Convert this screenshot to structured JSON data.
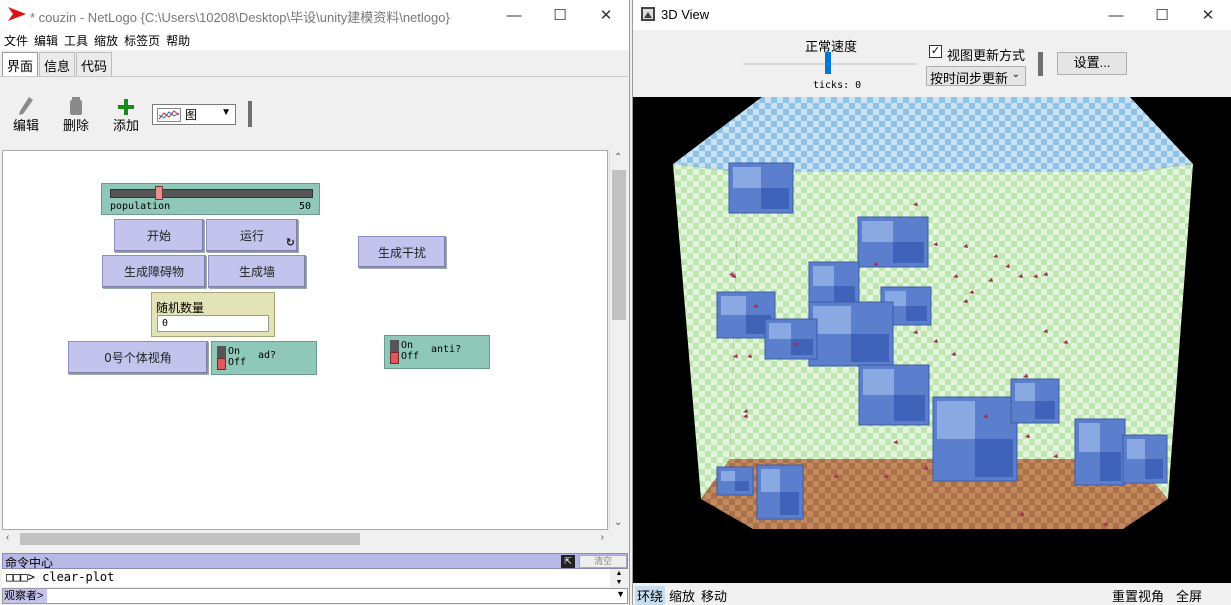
{
  "left_window": {
    "title": "* couzin - NetLogo {C:\\Users\\10208\\Desktop\\毕设\\unity建模资料\\netlogo}",
    "menu": [
      "文件",
      "编辑",
      "工具",
      "缩放",
      "标签页",
      "帮助"
    ],
    "tabs": [
      "界面",
      "信息",
      "代码"
    ],
    "toolbar": {
      "edit_label": "编辑",
      "delete_label": "删除",
      "add_label": "添加",
      "widget_type": "图"
    },
    "widgets": {
      "slider": {
        "name": "population",
        "value": "50",
        "fraction": 0.25
      },
      "buttons": {
        "setup": "开始",
        "go": "运行",
        "gen_obstacle": "生成障碍物",
        "gen_wall": "生成墙",
        "gen_disturb": "生成干扰",
        "agent0_view": "0号个体视角"
      },
      "input": {
        "label": "随机数量",
        "value": "0"
      },
      "switch_ad": {
        "on": "On",
        "off": "Off",
        "name": "ad?"
      },
      "switch_anti": {
        "on": "On",
        "off": "Off",
        "name": "anti?"
      }
    },
    "command_center": {
      "title": "命令中心",
      "clear_label": "清空",
      "output_line": "□□□> clear-plot",
      "observer_label": "观察者>"
    }
  },
  "right_window": {
    "title": "3D View",
    "speed_label": "正常速度",
    "ticks_text": "ticks: 0",
    "view_update_label": "视图更新方式",
    "view_update_checked": true,
    "update_mode": "按时间步更新",
    "settings_label": "设置...",
    "bottom_left": [
      "环绕",
      "缩放",
      "移动"
    ],
    "bottom_right": [
      "重置视角",
      "全屏"
    ],
    "colors": {
      "floor": "#a9704a",
      "wall": "#bfe6b0",
      "ceiling": "#8fc2e6",
      "cube": "#5b7fcc",
      "agents": "#9c2f55"
    }
  }
}
